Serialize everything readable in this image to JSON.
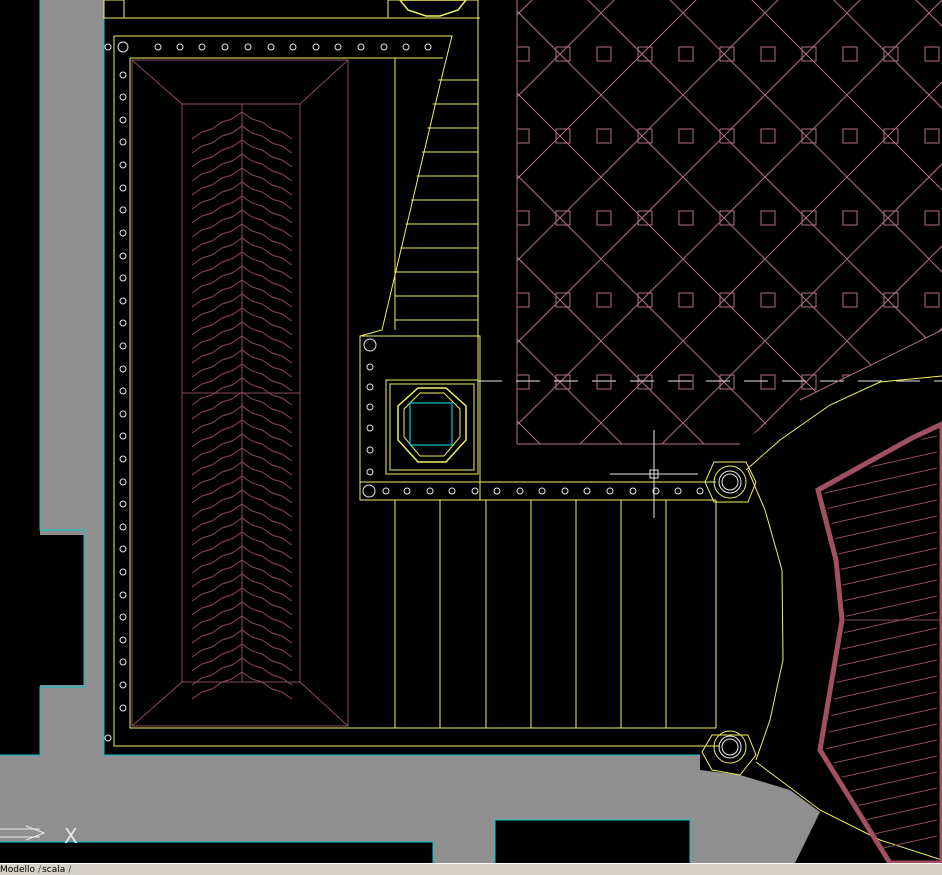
{
  "app": {
    "viewport_label": "model-space drawing view",
    "background_color": "#000000"
  },
  "colors": {
    "paving_gray": "#8f8f8f",
    "outline_cyan": "#00c8d0",
    "line_yellow": "#f0f060",
    "hatch_maroon": "#8a4a5a",
    "tile_mauve": "#b07080",
    "thick_border": "#a05060",
    "crosshair_white": "#e8e8e8"
  },
  "ucs_icon": {
    "name": "ucs-icon",
    "x_label": "X"
  },
  "tabs": {
    "model": "Modello",
    "sep1": "/",
    "layout": "scala",
    "sep2": "/"
  }
}
